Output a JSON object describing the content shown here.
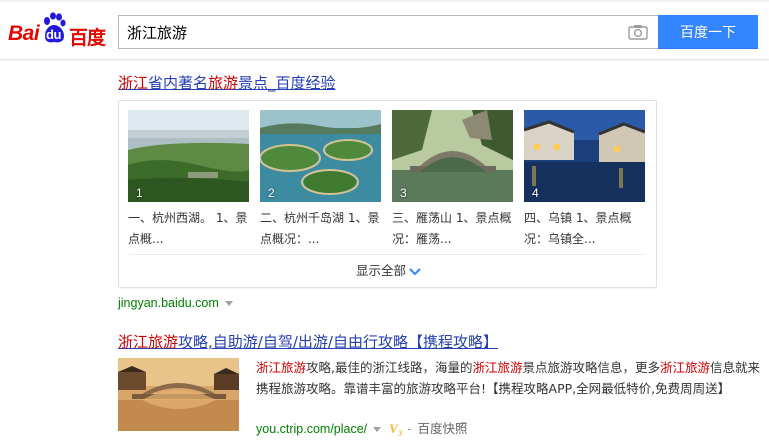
{
  "header": {
    "logo_en": "Bai",
    "logo_du": "du",
    "logo_cn": "百度",
    "search_value": "浙江旅游",
    "search_button": "百度一下"
  },
  "result1": {
    "title_parts": [
      "浙江",
      "省内著名",
      "旅游",
      "景点_百度经验"
    ],
    "cards": [
      {
        "num": "1",
        "caption": "一、杭州西湖。 1、景点概..."
      },
      {
        "num": "2",
        "caption": "二、杭州千岛湖 1、景点概况：..."
      },
      {
        "num": "3",
        "caption": "三、雁荡山 1、景点概况：雁荡..."
      },
      {
        "num": "4",
        "caption": "四、乌镇 1、景点概况：乌镇全..."
      }
    ],
    "show_all": "显示全部",
    "url": "jingyan.baidu.com"
  },
  "result2": {
    "title_parts": [
      "浙江旅游",
      "攻略,自助游/自驾/出游/自由行攻略【携程攻略】"
    ],
    "abstract_parts": [
      "浙江旅游",
      "攻略,最佳的浙江线路，海量的",
      "浙江旅游",
      "景点旅游攻略信息，更多",
      "浙江旅游",
      "信息就来携程旅游攻略。靠谱丰富的旅游攻略平台!【携程攻略APP,全网最低特价,免费周周送】"
    ],
    "url": "you.ctrip.com/place/",
    "v_badge": "V₃",
    "snapshot": "百度快照"
  },
  "colors": {
    "brand_red": "#e10602",
    "button_blue": "#3385ff",
    "link_blue": "#2440b3",
    "highlight_red": "#cc0000",
    "url_green": "#008000"
  },
  "icons": [
    "baidu-paw-icon",
    "camera-icon",
    "chevron-down-icon",
    "dropdown-triangle-icon"
  ]
}
